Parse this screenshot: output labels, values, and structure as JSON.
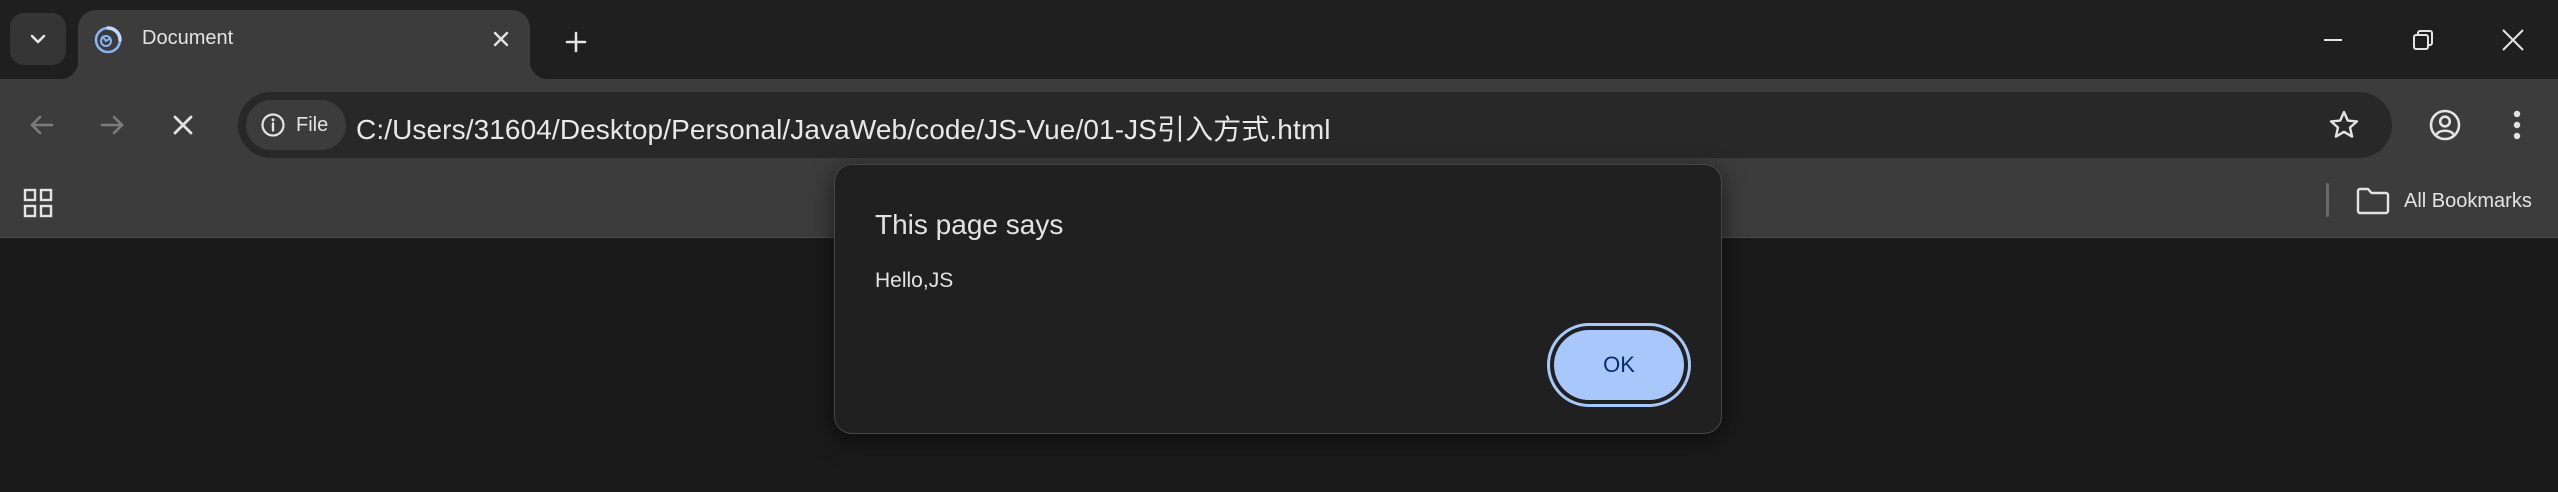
{
  "window": {
    "tab_title": "Document"
  },
  "toolbar": {
    "site_chip_label": "File",
    "url": "C:/Users/31604/Desktop/Personal/JavaWeb/code/JS-Vue/01-JS引入方式.html"
  },
  "bookmarks": {
    "all_bookmarks_label": "All Bookmarks"
  },
  "dialog": {
    "title": "This page says",
    "message": "Hello,JS",
    "ok_label": "OK"
  },
  "icons": {
    "tab_search": "chevron-down-icon",
    "favicon": "loading-globe-icon",
    "tab_close": "close-icon",
    "new_tab": "plus-icon",
    "minimize": "minimize-icon",
    "restore": "restore-icon",
    "close_window": "close-icon",
    "back": "arrow-left-icon",
    "forward": "arrow-right-icon",
    "stop": "stop-icon",
    "info": "info-icon",
    "bookmark_star": "star-icon",
    "profile": "profile-icon",
    "menu": "more-vert-icon",
    "apps": "apps-grid-icon",
    "folder": "folder-icon"
  },
  "colors": {
    "accent": "#a8c7fa",
    "accent_text": "#062e6f",
    "frame": "#1f1f1f",
    "toolbar": "#3c3c3c",
    "dialog_bg": "#202020"
  }
}
